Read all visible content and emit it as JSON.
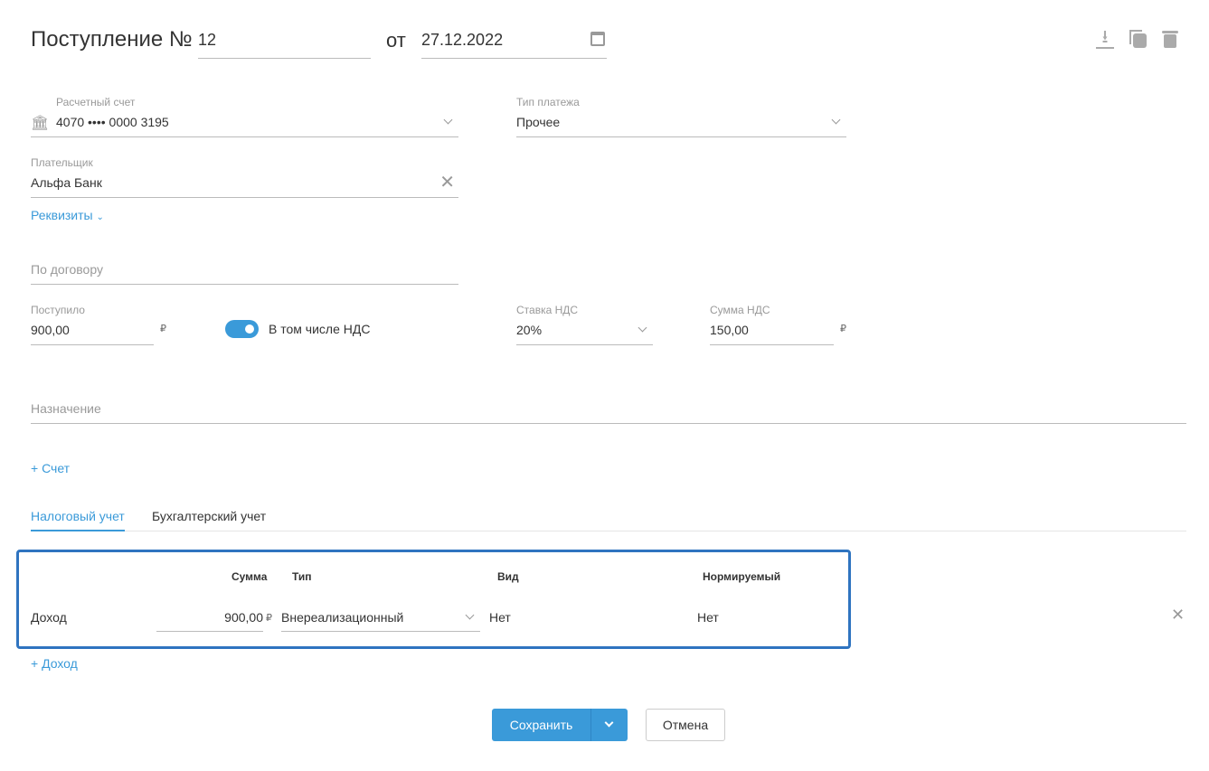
{
  "header": {
    "title": "Поступление №",
    "number": "12",
    "date_prefix": "от",
    "date": "27.12.2022"
  },
  "account": {
    "label": "Расчетный счет",
    "value": "4070 •••• 0000 3195"
  },
  "payment_type": {
    "label": "Тип платежа",
    "value": "Прочее"
  },
  "payer": {
    "label": "Плательщик",
    "value": "Альфа Банк"
  },
  "details_link": "Реквизиты",
  "contract": {
    "placeholder": "По договору"
  },
  "received": {
    "label": "Поступило",
    "value": "900,00",
    "currency": "₽"
  },
  "vat_toggle": {
    "label": "В том числе НДС",
    "on": true
  },
  "vat_rate": {
    "label": "Ставка НДС",
    "value": "20%"
  },
  "vat_sum": {
    "label": "Сумма НДС",
    "value": "150,00",
    "currency": "₽"
  },
  "purpose": {
    "placeholder": "Назначение"
  },
  "add_invoice": "+ Счет",
  "tabs": [
    {
      "label": "Налоговый учет",
      "active": true
    },
    {
      "label": "Бухгалтерский учет",
      "active": false
    }
  ],
  "table": {
    "headers": {
      "sum": "Сумма",
      "type": "Тип",
      "kind": "Вид",
      "normalized": "Нормируемый"
    },
    "rows": [
      {
        "name": "Доход",
        "sum": "900,00",
        "currency": "₽",
        "type": "Внереализационный",
        "kind": "Нет",
        "normalized": "Нет"
      }
    ]
  },
  "add_income": "+ Доход",
  "buttons": {
    "save": "Сохранить",
    "cancel": "Отмена"
  },
  "colors": {
    "accent": "#3a9ad9",
    "table_border": "#2f74c0"
  }
}
